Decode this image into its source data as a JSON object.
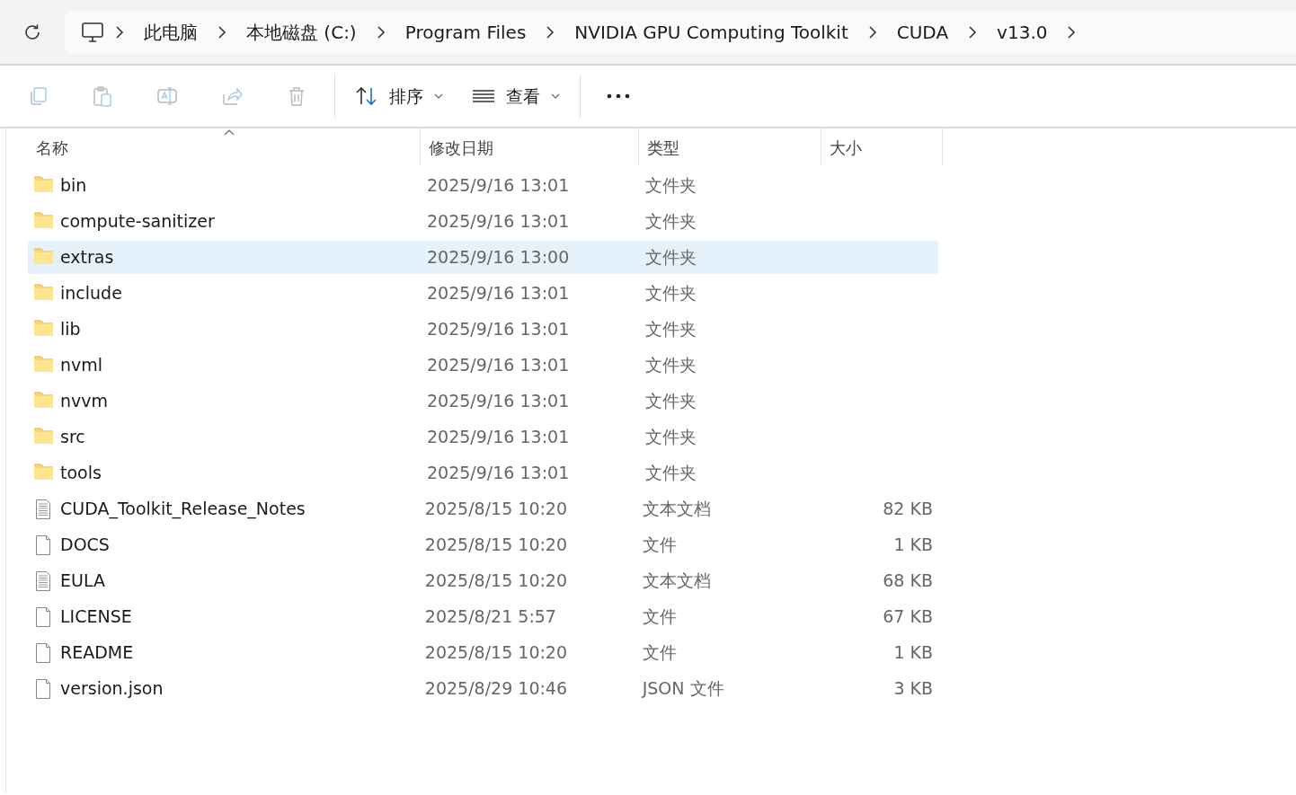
{
  "address_bar": {
    "crumbs": [
      "此电脑",
      "本地磁盘 (C:)",
      "Program Files",
      "NVIDIA GPU Computing Toolkit",
      "CUDA",
      "v13.0"
    ]
  },
  "toolbar": {
    "icon_buttons": [
      {
        "kind": "copy",
        "disabled": true
      },
      {
        "kind": "paste",
        "disabled": true
      },
      {
        "kind": "rename",
        "disabled": true
      },
      {
        "kind": "share",
        "disabled": true
      },
      {
        "kind": "delete",
        "disabled": true
      }
    ],
    "sort_button": {
      "label": "排序"
    },
    "view_button": {
      "label": "查看"
    }
  },
  "table": {
    "columns": [
      {
        "label": "名称",
        "sorted": true
      },
      {
        "label": "修改日期",
        "sorted": false
      },
      {
        "label": "类型",
        "sorted": false
      },
      {
        "label": "大小",
        "sorted": false
      }
    ],
    "rows": [
      {
        "kind": "folder",
        "name": "bin",
        "date": "2025/9/16 13:01",
        "type": "文件夹",
        "selected": false
      },
      {
        "kind": "folder",
        "name": "compute-sanitizer",
        "date": "2025/9/16 13:01",
        "type": "文件夹",
        "selected": false
      },
      {
        "kind": "folder",
        "name": "extras",
        "date": "2025/9/16 13:00",
        "type": "文件夹",
        "selected": true
      },
      {
        "kind": "folder",
        "name": "include",
        "date": "2025/9/16 13:01",
        "type": "文件夹",
        "selected": false
      },
      {
        "kind": "folder",
        "name": "lib",
        "date": "2025/9/16 13:01",
        "type": "文件夹",
        "selected": false
      },
      {
        "kind": "folder",
        "name": "nvml",
        "date": "2025/9/16 13:01",
        "type": "文件夹",
        "selected": false
      },
      {
        "kind": "folder",
        "name": "nvvm",
        "date": "2025/9/16 13:01",
        "type": "文件夹",
        "selected": false
      },
      {
        "kind": "folder",
        "name": "src",
        "date": "2025/9/16 13:01",
        "type": "文件夹",
        "selected": false
      },
      {
        "kind": "folder",
        "name": "tools",
        "date": "2025/9/16 13:01",
        "type": "文件夹",
        "selected": false
      },
      {
        "kind": "text",
        "name": "CUDA_Toolkit_Release_Notes",
        "date": "2025/8/15 10:20",
        "type": "文本文档",
        "size": "82 KB",
        "selected": false
      },
      {
        "kind": "file",
        "name": "DOCS",
        "date": "2025/8/15 10:20",
        "type": "文件",
        "size": "1 KB",
        "selected": false
      },
      {
        "kind": "text",
        "name": "EULA",
        "date": "2025/8/15 10:20",
        "type": "文本文档",
        "size": "68 KB",
        "selected": false
      },
      {
        "kind": "file",
        "name": "LICENSE",
        "date": "2025/8/21 5:57",
        "type": "文件",
        "size": "67 KB",
        "selected": false
      },
      {
        "kind": "file",
        "name": "README",
        "date": "2025/8/15 10:20",
        "type": "文件",
        "size": "1 KB",
        "selected": false
      },
      {
        "kind": "file",
        "name": "version.json",
        "date": "2025/8/29 10:46",
        "type": "JSON 文件",
        "size": "3 KB",
        "selected": false
      }
    ]
  }
}
